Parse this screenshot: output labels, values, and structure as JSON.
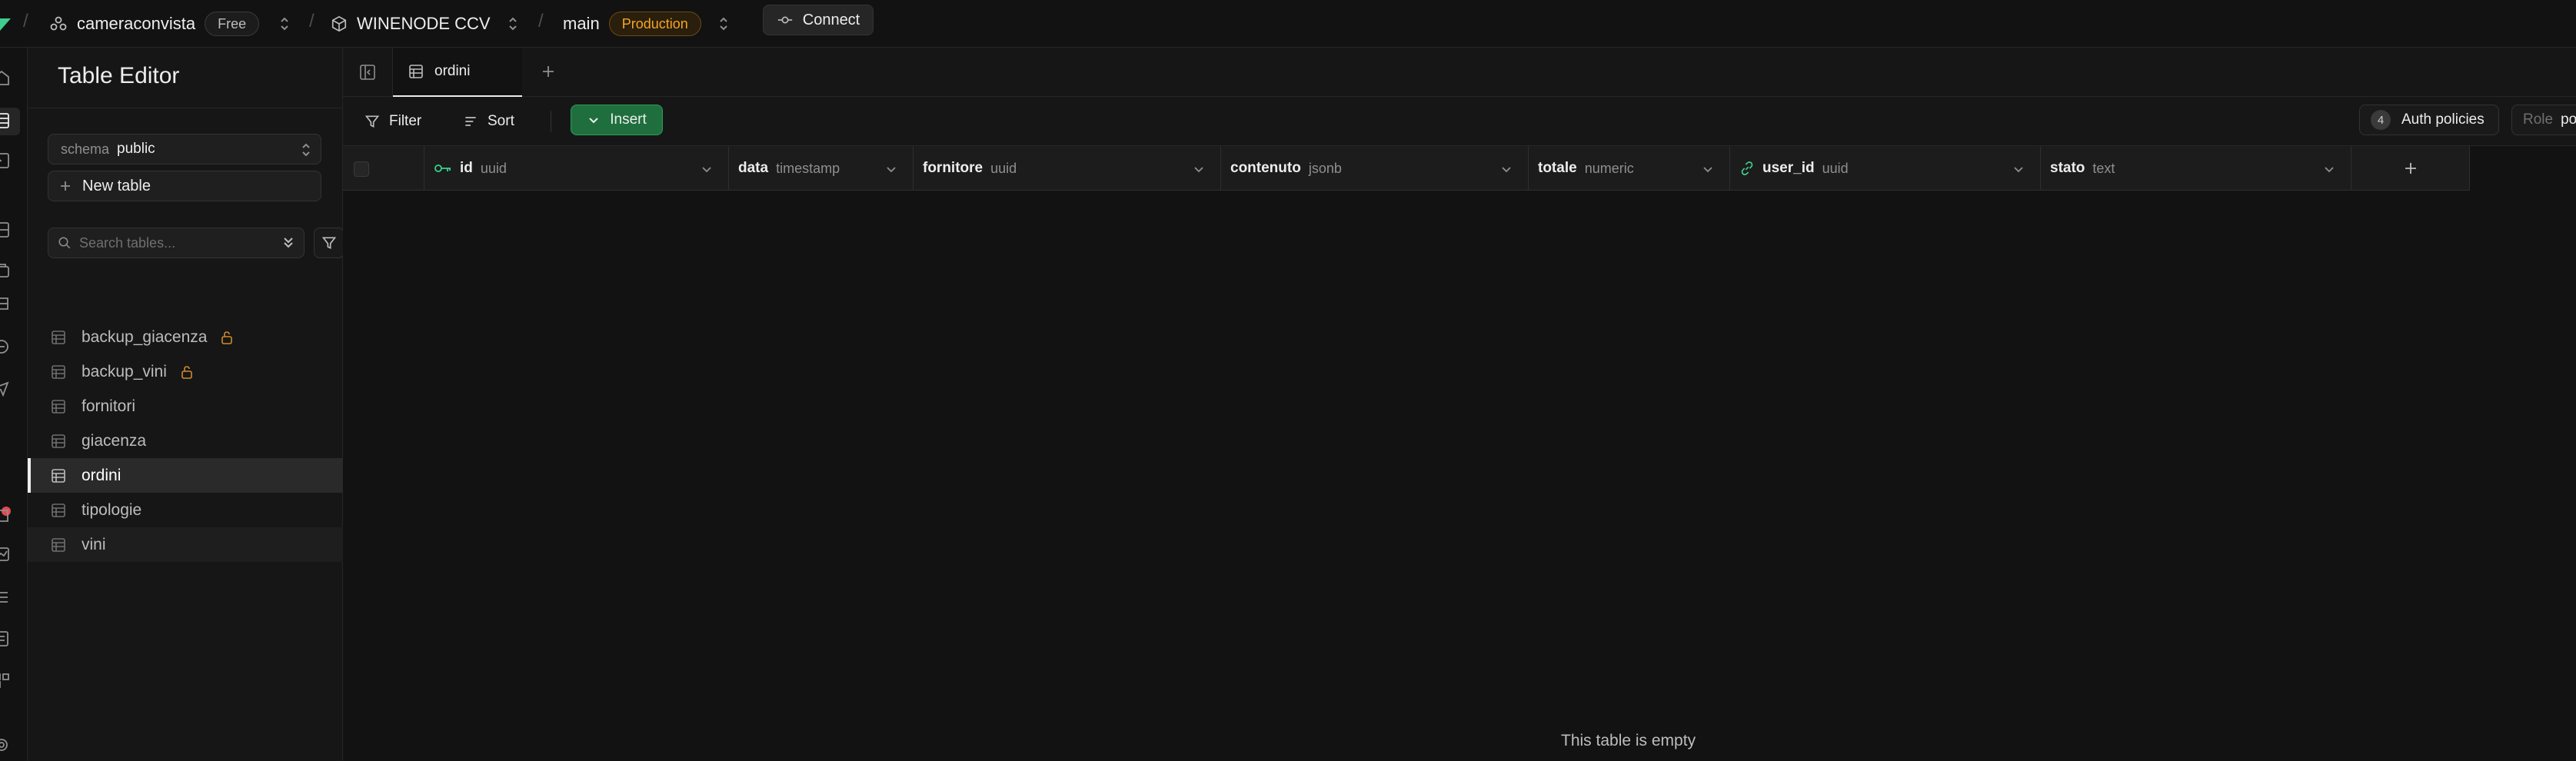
{
  "topbar": {
    "org_name": "cameraconvista",
    "org_plan": "Free",
    "project_name": "WINENODE CCV",
    "branch_name": "main",
    "branch_env": "Production",
    "connect_label": "Connect"
  },
  "sidebar": {
    "title": "Table Editor",
    "schema_label": "schema",
    "schema_value": "public",
    "new_table_label": "New table",
    "search_placeholder": "Search tables...",
    "tables": [
      {
        "name": "backup_giacenza",
        "locked": true
      },
      {
        "name": "backup_vini",
        "locked": true
      },
      {
        "name": "fornitori",
        "locked": false
      },
      {
        "name": "giacenza",
        "locked": false
      },
      {
        "name": "ordini",
        "locked": false,
        "active": true
      },
      {
        "name": "tipologie",
        "locked": false
      },
      {
        "name": "vini",
        "locked": false
      }
    ]
  },
  "tabs": [
    {
      "label": "ordini",
      "active": true
    }
  ],
  "toolbar": {
    "filter_label": "Filter",
    "sort_label": "Sort",
    "insert_label": "Insert",
    "auth_policies_count": "4",
    "auth_policies_label": "Auth policies",
    "role_label": "Role",
    "role_value": "postgres"
  },
  "columns": [
    {
      "name": "id",
      "type": "uuid",
      "icon": "key-icon"
    },
    {
      "name": "data",
      "type": "timestamp"
    },
    {
      "name": "fornitore",
      "type": "uuid"
    },
    {
      "name": "contenuto",
      "type": "jsonb"
    },
    {
      "name": "totale",
      "type": "numeric"
    },
    {
      "name": "user_id",
      "type": "uuid",
      "icon": "link-icon"
    },
    {
      "name": "stato",
      "type": "text"
    }
  ],
  "grid": {
    "empty_message": "This table is empty"
  },
  "colors": {
    "accent_green": "#3ecf8e",
    "insert_bg": "#1f6f3e",
    "production_orange": "#f5a524",
    "lock_orange": "#d08a2a",
    "notification_red": "#e5484d"
  }
}
